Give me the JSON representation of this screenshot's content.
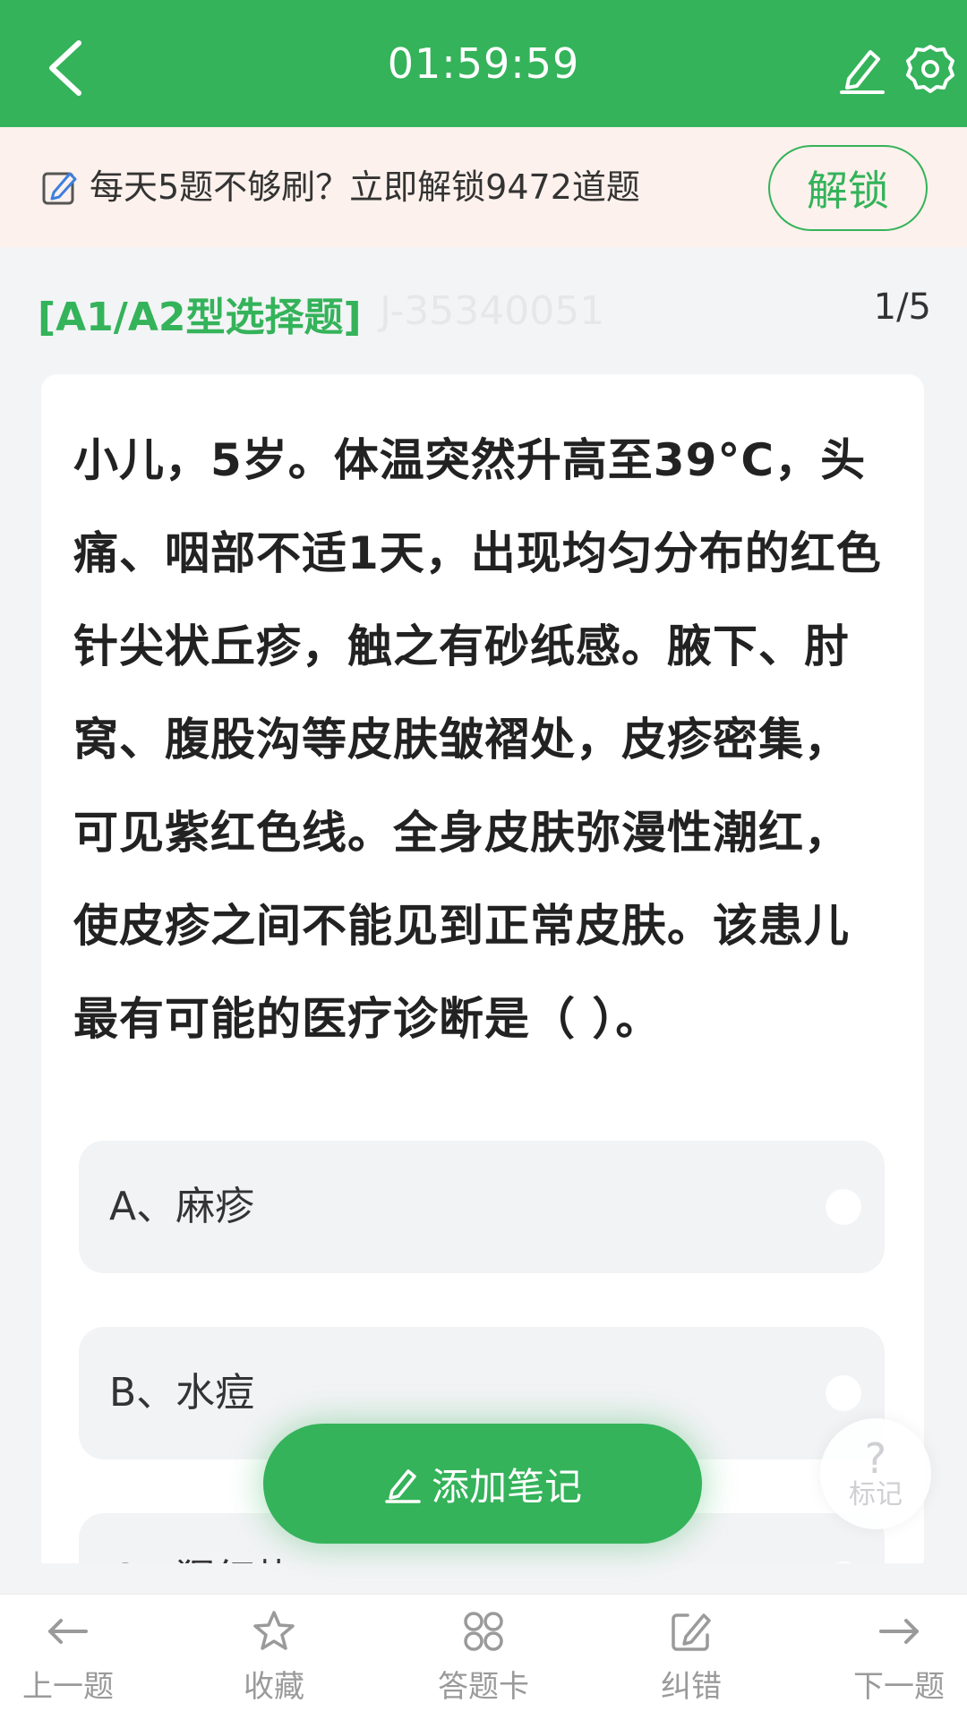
{
  "header": {
    "timer": "01:59:59",
    "back_icon": "chevron-left-icon",
    "pen_icon": "pen-icon",
    "settings_icon": "gear-icon"
  },
  "promo": {
    "text": "每天5题不够刷？立即解锁9472道题",
    "unlock_label": "解锁"
  },
  "question": {
    "type_label": "[A1/A2型选择题]",
    "id": "J-35340051",
    "progress": "1/5",
    "stem_lines": [
      "小儿，5岁。体温突然升高至39°C，头",
      "痛、咽部不适1天，出现均匀分布的红色",
      "针尖状丘疹，触之有砂纸感。腋下、肘",
      "窝、腹股沟等皮肤皱褶处，皮疹密集，",
      "可见紫红色线。全身皮肤弥漫性潮红，",
      "使皮疹之间不能见到正常皮肤。该患儿",
      "最有可能的医疗诊断是（ ）。"
    ],
    "options": [
      {
        "label": "A、麻疹"
      },
      {
        "label": "B、水痘"
      },
      {
        "label": "C、猩红热"
      }
    ]
  },
  "floating": {
    "add_note_label": "添加笔记",
    "mark_symbol": "?",
    "mark_label": "标记"
  },
  "tabbar": {
    "items": [
      {
        "label": "上一题",
        "icon": "arrow-left-icon"
      },
      {
        "label": "收藏",
        "icon": "star-icon"
      },
      {
        "label": "答题卡",
        "icon": "grid-icon"
      },
      {
        "label": "纠错",
        "icon": "edit-icon"
      },
      {
        "label": "下一题",
        "icon": "arrow-right-icon"
      }
    ]
  },
  "colors": {
    "brand_green": "#34b35a",
    "promo_bg": "#fcf1ec",
    "page_bg": "#f3f4f6"
  }
}
